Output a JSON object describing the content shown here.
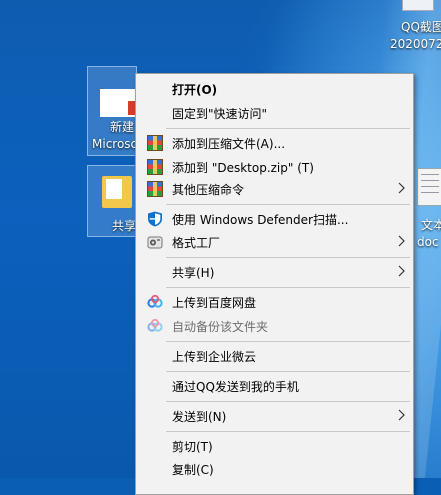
{
  "desktop": {
    "icons": [
      {
        "name": "qq-screenshot",
        "line1": "QQ截图",
        "line2": "2020072"
      },
      {
        "name": "new-file",
        "line1": "新建",
        "line2": "Microsc"
      },
      {
        "name": "share-folder",
        "line1": "共享"
      },
      {
        "name": "text-file",
        "line1": "文本",
        "line2": "doc"
      }
    ]
  },
  "menu": {
    "items": [
      {
        "label": "打开(O)"
      },
      {
        "label": "固定到\"快速访问\""
      },
      {
        "label": "添加到压缩文件(A)...",
        "icon": "winrar-icon"
      },
      {
        "label": "添加到 \"Desktop.zip\" (T)",
        "icon": "winrar-icon"
      },
      {
        "label": "其他压缩命令",
        "icon": "winrar-icon"
      },
      {
        "label": "使用 Windows Defender扫描...",
        "icon": "windows-defender-shield-icon"
      },
      {
        "label": "格式工厂",
        "icon": "format-factory-icon"
      },
      {
        "label": "共享(H)"
      },
      {
        "label": "上传到百度网盘",
        "icon": "baidu-netdisk-icon"
      },
      {
        "label": "自动备份该文件夹",
        "icon": "baidu-netdisk-icon",
        "disabled": true
      },
      {
        "label": "上传到企业微云"
      },
      {
        "label": "通过QQ发送到我的手机"
      },
      {
        "label": "发送到(N)"
      },
      {
        "label": "剪切(T)"
      },
      {
        "label": "复制(C)"
      }
    ]
  },
  "colors": {
    "menu_bg": "#f2f2f2",
    "separator": "#c9c9c9",
    "desktop_blue": "#0b61bd",
    "disabled_text": "#6d6d6d"
  }
}
